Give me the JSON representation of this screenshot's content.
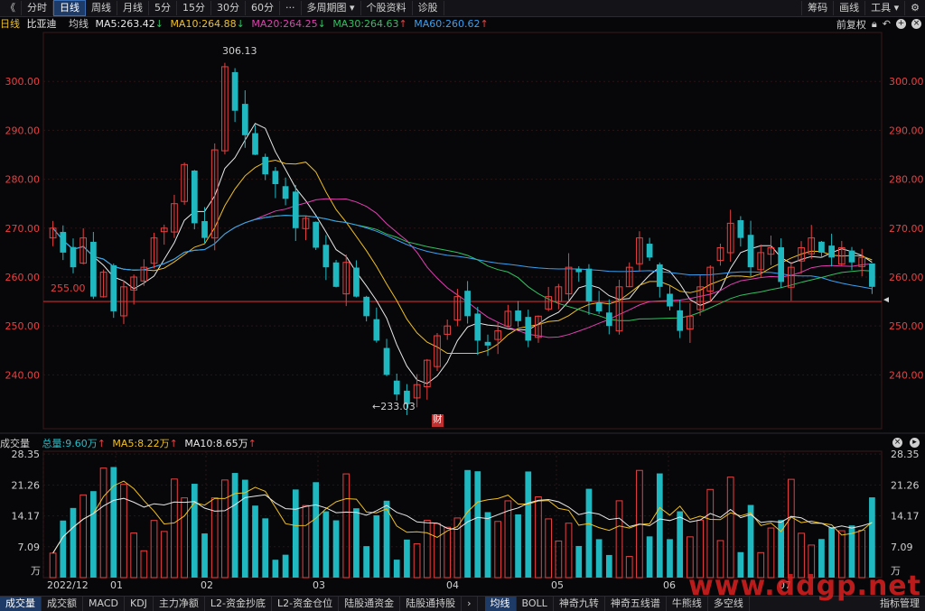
{
  "toolbar": {
    "back_glyph": "《",
    "tabs": [
      {
        "label": "分时",
        "active": false
      },
      {
        "label": "日线",
        "active": true
      },
      {
        "label": "周线",
        "active": false
      },
      {
        "label": "月线",
        "active": false
      },
      {
        "label": "5分",
        "active": false
      },
      {
        "label": "15分",
        "active": false
      },
      {
        "label": "30分",
        "active": false
      },
      {
        "label": "60分",
        "active": false
      },
      {
        "label": "···",
        "active": false
      },
      {
        "label": "多周期图 ▾",
        "active": false
      },
      {
        "label": "个股资料",
        "active": false
      },
      {
        "label": "诊股",
        "active": false
      }
    ],
    "right": [
      "筹码",
      "画线",
      "工具 ▾"
    ],
    "settings_icon": "gear-icon"
  },
  "legend": {
    "period": "日线",
    "stock": "比亚迪",
    "ma_label": "均线",
    "items": [
      {
        "text": "MA5:263.42",
        "arrow": "↓",
        "color": "#e8e8e8"
      },
      {
        "text": "MA10:264.88",
        "arrow": "↓",
        "color": "#f0c020"
      },
      {
        "text": "MA20:264.25",
        "arrow": "↓",
        "color": "#e040b0"
      },
      {
        "text": "MA30:264.63",
        "arrow": "↑",
        "color": "#30c060"
      },
      {
        "text": "MA60:260.62",
        "arrow": "↑",
        "color": "#3aa0f0"
      }
    ],
    "right_label": "前复权",
    "right_icons": [
      "lock-icon",
      "undo-icon",
      "add-icon",
      "close-icon"
    ]
  },
  "price_axis": {
    "ticks": [
      "300.00",
      "290.00",
      "280.00",
      "270.00",
      "260.00",
      "250.00",
      "240.00"
    ],
    "ref_line": "255.00",
    "high_label": "306.13",
    "low_label": "←233.03",
    "finance_badge": "财"
  },
  "volume_legend": {
    "title": "成交量",
    "items": [
      {
        "text": "总量:9.60万",
        "arrow": "↑",
        "color": "#20c0c8"
      },
      {
        "text": "MA5:8.22万",
        "arrow": "↑",
        "color": "#f0c020"
      },
      {
        "text": "MA10:8.65万",
        "arrow": "↑",
        "color": "#e8e8e8"
      }
    ],
    "right_icons": [
      "close-icon",
      "expand-icon"
    ]
  },
  "volume_axis": {
    "ticks": [
      "28.35",
      "21.26",
      "14.17",
      "7.09"
    ],
    "unit": "万"
  },
  "date_axis": [
    "2022/12",
    "01",
    "02",
    "03",
    "04",
    "05",
    "06",
    "07"
  ],
  "bottom_tabs": {
    "left": [
      {
        "label": "成交量",
        "active": true
      },
      {
        "label": "成交额",
        "active": false
      },
      {
        "label": "MACD",
        "active": false
      },
      {
        "label": "KDJ",
        "active": false
      },
      {
        "label": "主力净额",
        "active": false
      },
      {
        "label": "L2-资金抄底",
        "active": false
      },
      {
        "label": "L2-资金仓位",
        "active": false
      },
      {
        "label": "陆股通资金",
        "active": false
      },
      {
        "label": "陆股通持股",
        "active": false
      }
    ],
    "arrow": "›",
    "right": [
      {
        "label": "均线",
        "active": true
      },
      {
        "label": "BOLL",
        "active": false
      },
      {
        "label": "神奇九转",
        "active": false
      },
      {
        "label": "神奇五线谱",
        "active": false
      },
      {
        "label": "牛熊线",
        "active": false
      },
      {
        "label": "多空线",
        "active": false
      },
      {
        "label": "指标管理",
        "active": false
      }
    ]
  },
  "watermark": "www.ddgp.net",
  "colors": {
    "up": "#e84040",
    "down": "#20b8c0",
    "ma5": "#e8e8e8",
    "ma10": "#f0c020",
    "ma20": "#e040b0",
    "ma30": "#30c060",
    "ma60": "#3aa0f0",
    "axis_text": "#e84040",
    "grid": "#2a1414"
  },
  "chart_data": {
    "type": "candlestick",
    "price_range": [
      229,
      310
    ],
    "volume_range_wan": [
      0,
      29
    ],
    "price_closes": [
      270,
      265,
      262,
      268,
      256,
      261,
      253,
      258,
      260,
      262,
      268,
      270,
      275,
      283,
      271,
      268,
      286,
      303,
      294,
      289,
      285,
      281,
      279,
      276,
      270,
      272,
      266,
      262,
      258,
      263,
      256,
      252,
      247,
      240,
      236,
      234,
      238,
      243,
      248,
      250,
      256,
      252,
      247,
      246,
      249,
      253,
      251,
      247,
      252,
      256,
      258,
      262,
      261,
      255,
      253,
      250,
      258,
      262,
      268,
      264,
      258,
      254,
      249,
      252,
      258,
      262,
      266,
      271,
      268,
      262,
      265,
      266,
      259,
      262,
      266,
      268,
      265,
      264,
      266,
      263,
      264,
      258
    ]
  }
}
